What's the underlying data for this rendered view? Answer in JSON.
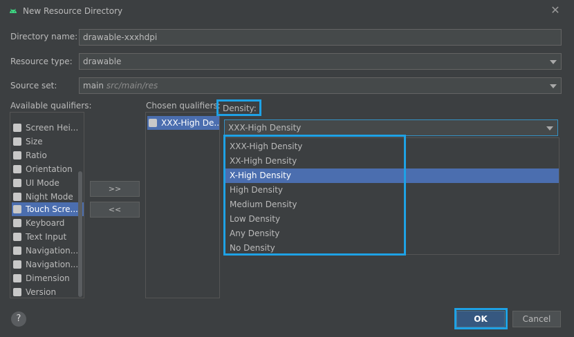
{
  "window": {
    "title": "New Resource Directory",
    "close_symbol": "✕"
  },
  "form": {
    "directory_name_label": "Directory name:",
    "directory_name_value": "drawable-xxxhdpi",
    "resource_type_label": "Resource type:",
    "resource_type_value": "drawable",
    "source_set_label": "Source set:",
    "source_set_value": "main",
    "source_set_path": "src/main/res"
  },
  "available": {
    "label": "Available qualifiers:",
    "items": [
      {
        "label": "Screen Hei...",
        "icon": "screen-height-icon"
      },
      {
        "label": "Size",
        "icon": "size-icon"
      },
      {
        "label": "Ratio",
        "icon": "ratio-icon"
      },
      {
        "label": "Orientation",
        "icon": "orientation-icon"
      },
      {
        "label": "UI Mode",
        "icon": "ui-mode-icon"
      },
      {
        "label": "Night Mode",
        "icon": "night-mode-icon"
      },
      {
        "label": "Touch Scre...",
        "icon": "touch-screen-icon"
      },
      {
        "label": "Keyboard",
        "icon": "keyboard-icon"
      },
      {
        "label": "Text Input",
        "icon": "text-input-icon"
      },
      {
        "label": "Navigation...",
        "icon": "navigation-icon"
      },
      {
        "label": "Navigation...",
        "icon": "navigation-icon"
      },
      {
        "label": "Dimension",
        "icon": "dimension-icon"
      },
      {
        "label": "Version",
        "icon": "version-icon"
      }
    ]
  },
  "move": {
    "add_label": ">>",
    "remove_label": "<<"
  },
  "chosen": {
    "label": "Chosen qualifiers:",
    "items": [
      {
        "label": "XXX-High De...",
        "icon": "density-icon"
      }
    ]
  },
  "density": {
    "label": "Density:",
    "selected": "XXX-High Density",
    "options": [
      "XXX-High Density",
      "XX-High Density",
      "X-High Density",
      "High Density",
      "Medium Density",
      "Low Density",
      "Any Density",
      "No Density"
    ],
    "highlighted_option": "X-High Density"
  },
  "footer": {
    "help_label": "?",
    "ok_label": "OK",
    "cancel_label": "Cancel"
  },
  "colors": {
    "background": "#3c3f41",
    "selection": "#4b6eaf",
    "highlight_box": "#1ea2e6",
    "primary_button": "#365880"
  }
}
